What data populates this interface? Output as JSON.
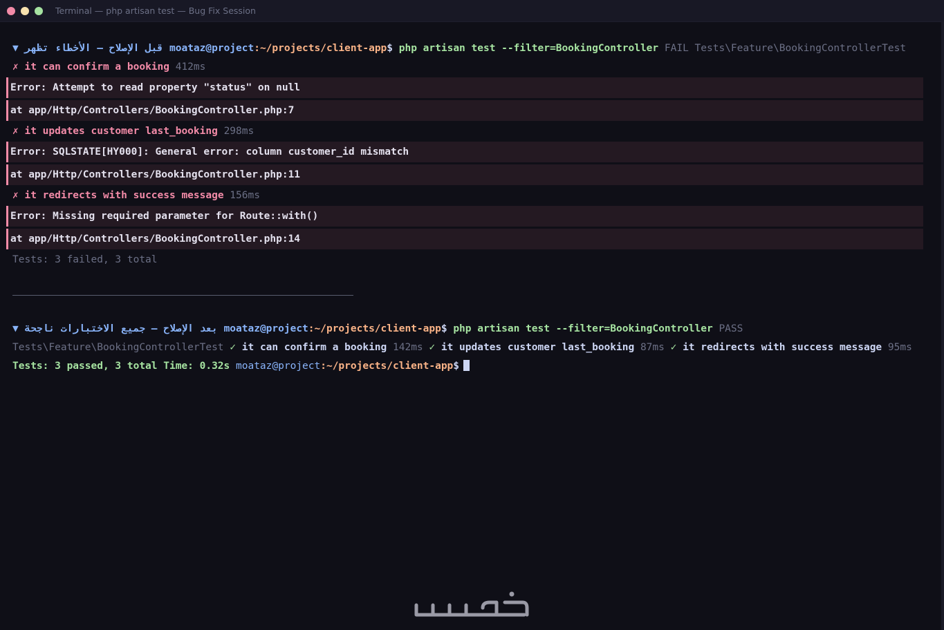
{
  "window": {
    "title": "Terminal — php artisan test — Bug Fix Session"
  },
  "before": {
    "arrow": "▼",
    "heading": "قبل الإصلاح — الأخطاء تظهر",
    "user_host": "moataz@project",
    "path": ":~/projects/client-app",
    "prompt_sign": "$",
    "command": "php artisan test --filter=BookingController",
    "status": "FAIL",
    "suite": "Tests\\Feature\\BookingControllerTest",
    "tests": [
      {
        "mark": "✗",
        "name": "it can confirm a booking",
        "time": "412ms",
        "error": "Error: Attempt to read property \"status\" on null",
        "location": "at app/Http/Controllers/BookingController.php:7"
      },
      {
        "mark": "✗",
        "name": "it updates customer last_booking",
        "time": "298ms",
        "error": "Error: SQLSTATE[HY000]: General error: column customer_id mismatch",
        "location": "at app/Http/Controllers/BookingController.php:11"
      },
      {
        "mark": "✗",
        "name": "it redirects with success message",
        "time": "156ms",
        "error": "Error: Missing required parameter for Route::with()",
        "location": "at app/Http/Controllers/BookingController.php:14"
      }
    ],
    "summary": "Tests: 3 failed, 3 total"
  },
  "after": {
    "arrow": "▼",
    "heading": "بعد الإصلاح — جميع الاختبارات ناجحة",
    "user_host": "moataz@project",
    "path": ":~/projects/client-app",
    "prompt_sign": "$",
    "command": "php artisan test --filter=BookingController",
    "status": "PASS",
    "suite": "Tests\\Feature\\BookingControllerTest",
    "tests": [
      {
        "mark": "✓",
        "name": "it can confirm a booking",
        "time": "142ms"
      },
      {
        "mark": "✓",
        "name": "it updates customer last_booking",
        "time": "87ms"
      },
      {
        "mark": "✓",
        "name": "it redirects with success message",
        "time": "95ms"
      }
    ],
    "summary": "Tests: 3 passed, 3 total Time: 0.32s",
    "final_user_host": "moataz@project",
    "final_path": ":~/projects/client-app",
    "final_prompt_sign": "$"
  },
  "logo": {
    "text": "خمسات"
  },
  "colors": {
    "background": "#0f0f17",
    "user_host": "#89b4fa",
    "path": "#fab387",
    "command": "#a6e3a1",
    "fail": "#f38ba8",
    "muted": "#6c7086",
    "error_bg": "#241922"
  }
}
